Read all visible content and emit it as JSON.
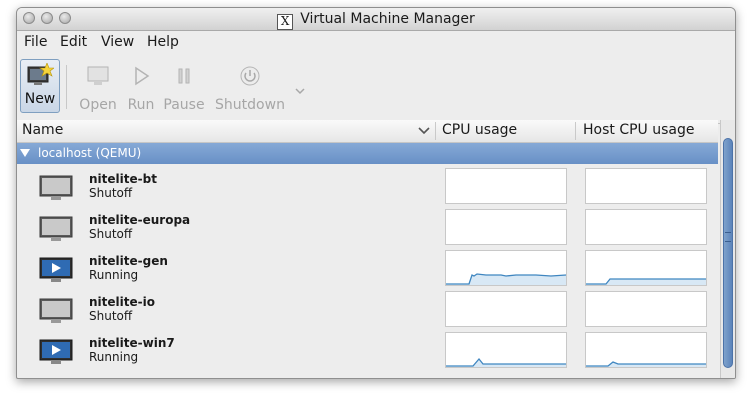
{
  "window": {
    "title": "Virtual Machine Manager"
  },
  "menu": {
    "file": "File",
    "edit": "Edit",
    "view": "View",
    "help": "Help"
  },
  "toolbar": {
    "new_label": "New",
    "open_label": "Open",
    "run_label": "Run",
    "pause_label": "Pause",
    "shutdown_label": "Shutdown"
  },
  "columns": {
    "name": "Name",
    "cpu": "CPU usage",
    "host_cpu": "Host CPU usage"
  },
  "group": {
    "label": "localhost (QEMU)"
  },
  "vms": [
    {
      "name": "nitelite-bt",
      "status": "Shutoff",
      "running": false
    },
    {
      "name": "nitelite-europa",
      "status": "Shutoff",
      "running": false
    },
    {
      "name": "nitelite-gen",
      "status": "Running",
      "running": true
    },
    {
      "name": "nitelite-io",
      "status": "Shutoff",
      "running": false
    },
    {
      "name": "nitelite-win7",
      "status": "Running",
      "running": true
    }
  ],
  "colors": {
    "accent": "#6890c6",
    "graph_line": "#3f86c0",
    "graph_fill": "#d8e8f5"
  }
}
